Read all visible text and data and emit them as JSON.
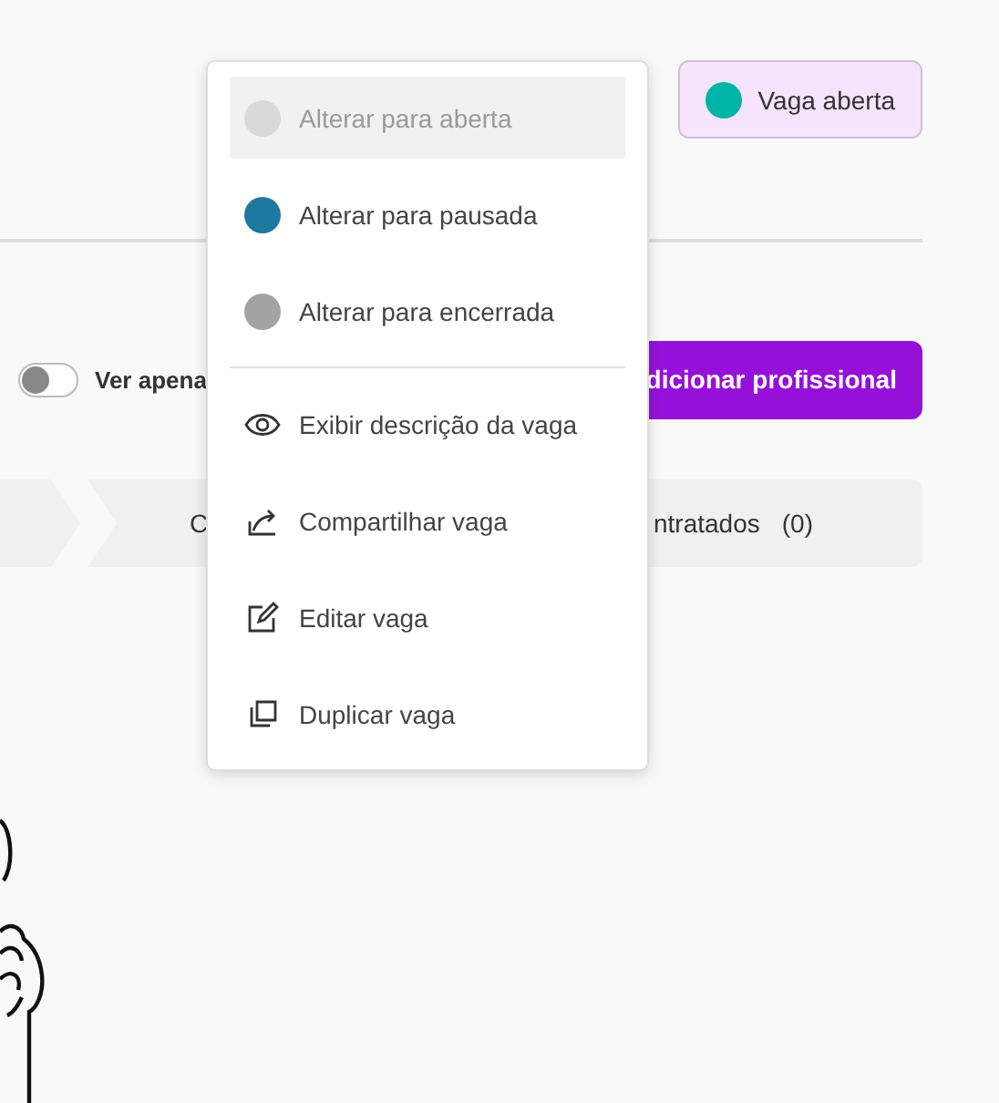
{
  "status_badge": {
    "label": "Vaga aberta",
    "color": "#00b5a5"
  },
  "toggle": {
    "label": "Ver apena",
    "on": false
  },
  "add_button": {
    "label": "dicionar profissional"
  },
  "steps": [
    {
      "label": "C"
    },
    {
      "label": "ntratados",
      "count": "(0)"
    }
  ],
  "menu": {
    "items": [
      {
        "kind": "status",
        "label": "Alterar para aberta",
        "color": "#d9d9d9",
        "disabled": true
      },
      {
        "kind": "status",
        "label": "Alterar para pausada",
        "color": "#1f78a0",
        "disabled": false
      },
      {
        "kind": "status",
        "label": "Alterar para encerrada",
        "color": "#a3a3a3",
        "disabled": false
      },
      {
        "kind": "divider"
      },
      {
        "kind": "view",
        "label": "Exibir descrição da vaga",
        "disabled": false
      },
      {
        "kind": "share",
        "label": "Compartilhar vaga",
        "disabled": false
      },
      {
        "kind": "edit",
        "label": "Editar vaga",
        "disabled": false
      },
      {
        "kind": "duplicate",
        "label": "Duplicar vaga",
        "disabled": false
      }
    ]
  }
}
